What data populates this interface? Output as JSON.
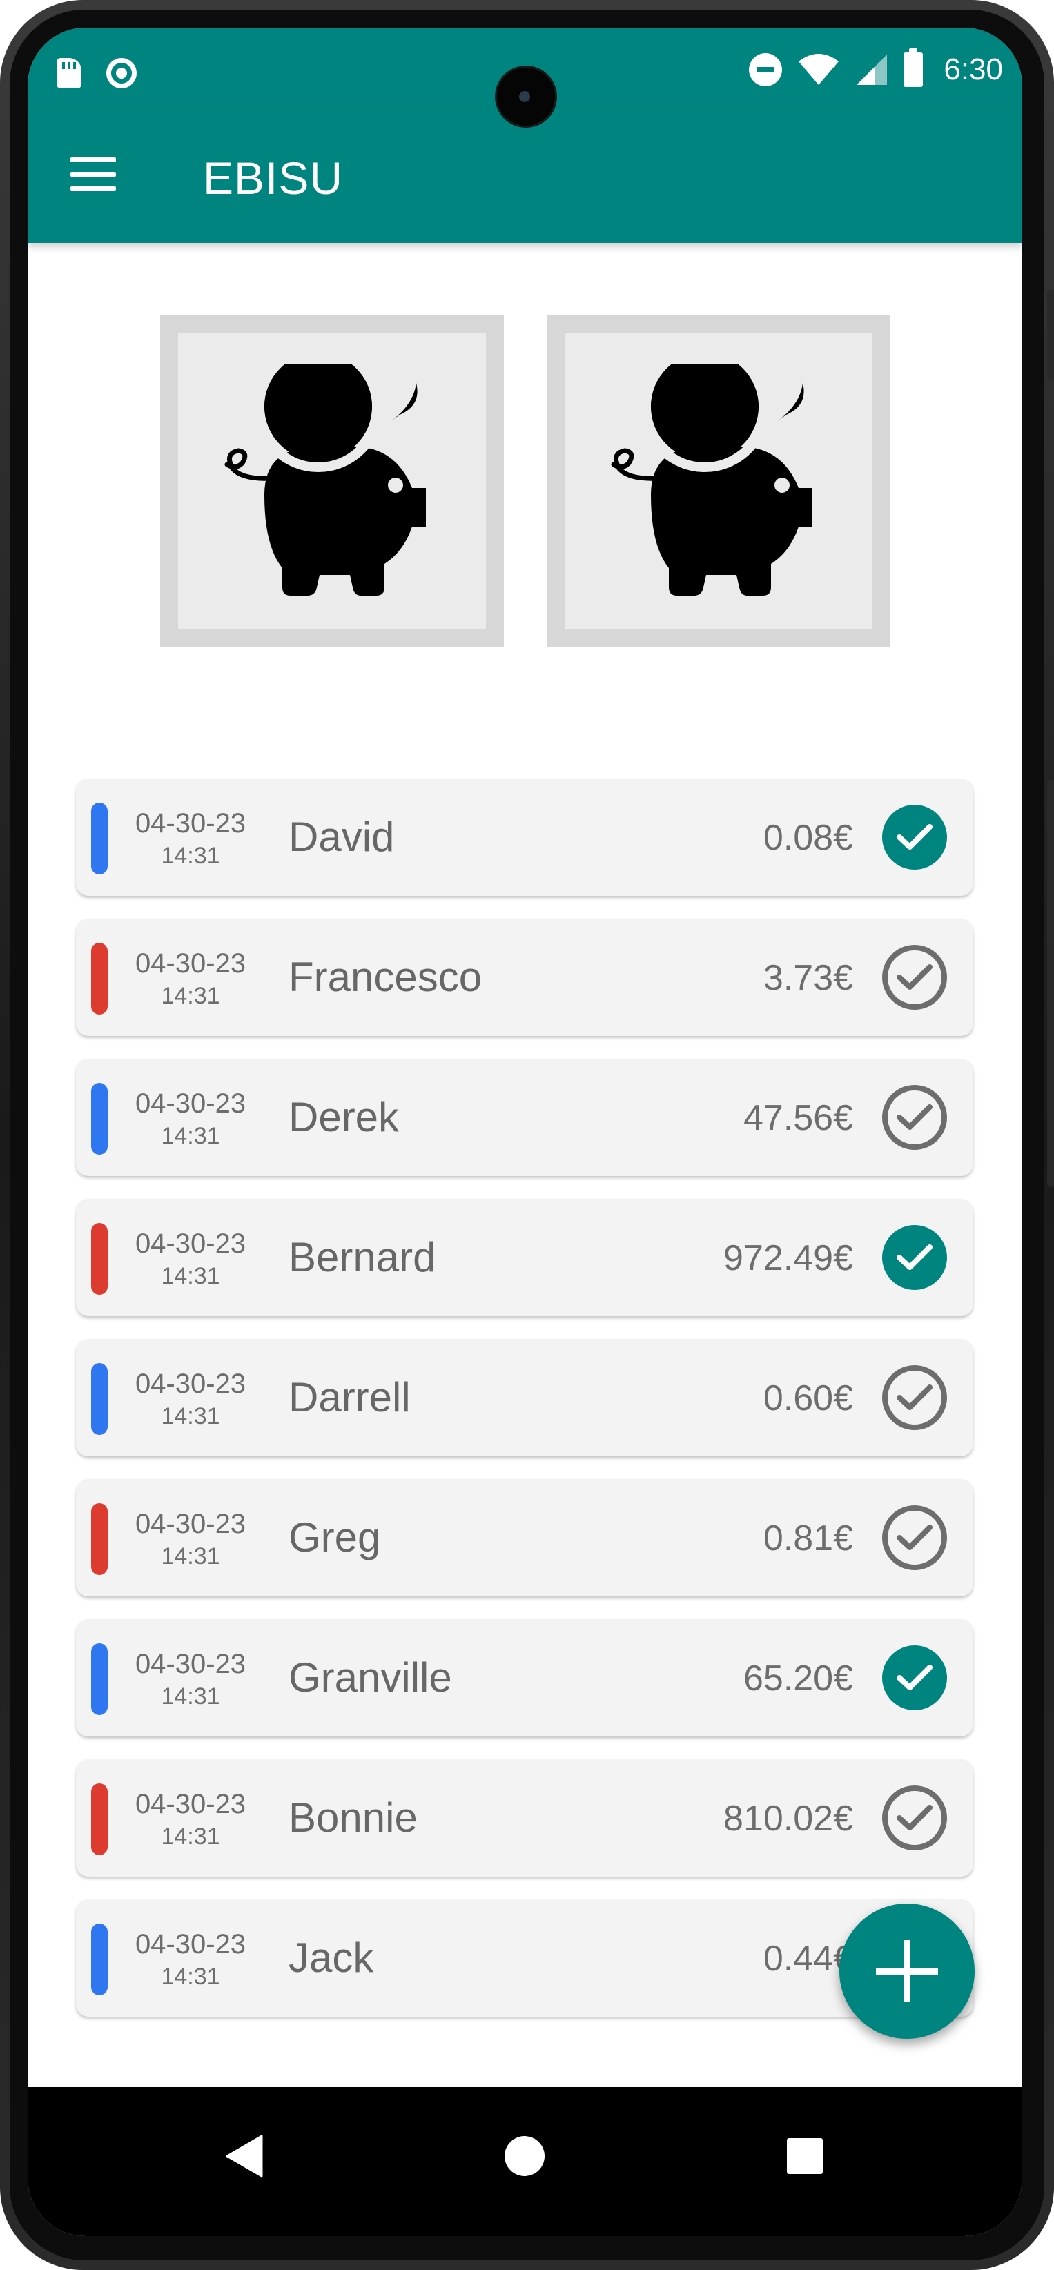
{
  "status_bar": {
    "time": "6:30",
    "left_icons": [
      "sd-card-icon",
      "sync-ring-icon"
    ],
    "right_icons": [
      "do-not-disturb-icon",
      "wifi-icon",
      "cellular-signal-icon",
      "battery-icon"
    ]
  },
  "app_bar": {
    "title": "EBISU",
    "menu_icon": "hamburger-menu-icon"
  },
  "piggy_banks": [
    {
      "icon": "piggy-bank-icon"
    },
    {
      "icon": "piggy-bank-icon"
    }
  ],
  "colors": {
    "primary": "#00847f",
    "income_stripe": "#2f77f1",
    "expense_stripe": "#de3b30",
    "row_background": "#f3f3f3",
    "text_gray": "#6d6d6d"
  },
  "transactions": [
    {
      "type": "blue",
      "date": "04-30-23",
      "time": "14:31",
      "name": "David",
      "amount": "0.08€",
      "checked": true
    },
    {
      "type": "red",
      "date": "04-30-23",
      "time": "14:31",
      "name": "Francesco",
      "amount": "3.73€",
      "checked": false
    },
    {
      "type": "blue",
      "date": "04-30-23",
      "time": "14:31",
      "name": "Derek",
      "amount": "47.56€",
      "checked": false
    },
    {
      "type": "red",
      "date": "04-30-23",
      "time": "14:31",
      "name": "Bernard",
      "amount": "972.49€",
      "checked": true
    },
    {
      "type": "blue",
      "date": "04-30-23",
      "time": "14:31",
      "name": "Darrell",
      "amount": "0.60€",
      "checked": false
    },
    {
      "type": "red",
      "date": "04-30-23",
      "time": "14:31",
      "name": "Greg",
      "amount": "0.81€",
      "checked": false
    },
    {
      "type": "blue",
      "date": "04-30-23",
      "time": "14:31",
      "name": "Granville",
      "amount": "65.20€",
      "checked": true
    },
    {
      "type": "red",
      "date": "04-30-23",
      "time": "14:31",
      "name": "Bonnie",
      "amount": "810.02€",
      "checked": false
    },
    {
      "type": "blue",
      "date": "04-30-23",
      "time": "14:31",
      "name": "Jack",
      "amount": "0.44€",
      "checked": false
    }
  ],
  "fab": {
    "icon": "add-icon"
  },
  "nav_bar": {
    "back_icon": "back-triangle-icon",
    "home_icon": "home-circle-icon",
    "recents_icon": "recents-square-icon"
  }
}
